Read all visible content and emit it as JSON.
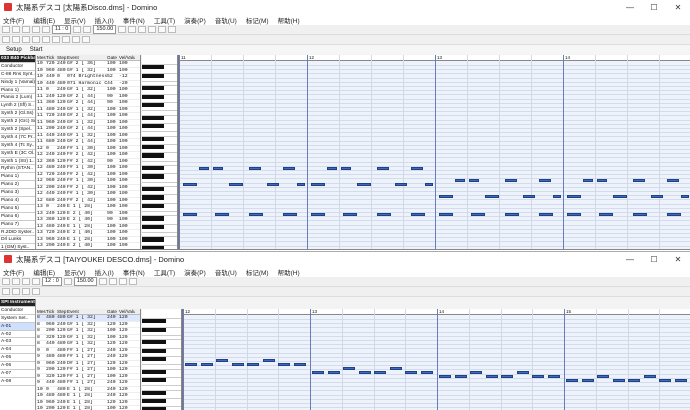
{
  "win1": {
    "title": "太陽系デスコ [太陽系Disco.dms] - Domino",
    "menu": [
      "文件(F)",
      "编辑(E)",
      "显示(V)",
      "插入(I)",
      "事件(N)",
      "工具(T)",
      "演奏(P)",
      "音轨(U)",
      "标记(M)",
      "帮助(H)"
    ],
    "measure": "11 : 0",
    "tempo": "150.00",
    "tabs": [
      "Setup",
      "Start"
    ],
    "track_header": "033 B40 Pickba 2 *0",
    "tracks": [
      "Conductor",
      "C-86 Rns Synt..",
      "Nindy 1 (Vamal)",
      "Piano 1)",
      "Pianio 2 (Lum)",
      "Lynth 2 (Sfl) S..",
      "Synth 2 (Gl.Ss)",
      "Synth 2 (Grc) Sun.",
      "Synth 2 (Spel..",
      "Synth 4 (7C Pr..",
      "Synth 4 (Tc Sy..",
      "Synth E (3C Ol..",
      "Synth 1 (Str) 1..",
      "Rythm (STAN..",
      "Piano 1)",
      "Piano 2)",
      "Piano 3)",
      "Piano 4)",
      "Piano 5)",
      "Piano 6)",
      "Piano 7)",
      "R.2DID Syster..",
      "Drl Lunks",
      "1 (GM) Syst.."
    ],
    "ev_cols": [
      "Mes",
      "Tick",
      "Step",
      "Event",
      "Gate",
      "Vel/Value"
    ],
    "events": [
      [
        "10",
        "720",
        "240",
        "G# 2 [ 36]",
        "100",
        "100"
      ],
      [
        "10",
        "960",
        "480",
        "G# 1 [ 32]",
        "100",
        "100"
      ],
      [
        "10",
        "440",
        "0",
        "074 Brightness 12(7 2)",
        "52",
        "-12"
      ],
      [
        "10",
        "440",
        "480",
        "071 Harmonic Content",
        "44",
        "-20"
      ],
      [
        "11",
        "0",
        "240",
        "G# 1 [ 32]",
        "100",
        "100"
      ],
      [
        "11",
        "240",
        "120",
        "G# 2 [ 44]",
        "90",
        "100"
      ],
      [
        "11",
        "360",
        "120",
        "G# 2 [ 44]",
        "90",
        "100"
      ],
      [
        "11",
        "480",
        "240",
        "G# 1 [ 32]",
        "100",
        "100"
      ],
      [
        "11",
        "720",
        "240",
        "G# 2 [ 44]",
        "100",
        "100"
      ],
      [
        "11",
        "960",
        "240",
        "G# 1 [ 32]",
        "100",
        "100"
      ],
      [
        "11",
        "200",
        "240",
        "G# 2 [ 44]",
        "100",
        "100"
      ],
      [
        "11",
        "440",
        "240",
        "G# 1 [ 32]",
        "100",
        "100"
      ],
      [
        "11",
        "680",
        "240",
        "G# 2 [ 44]",
        "100",
        "100"
      ],
      [
        "12",
        "0",
        "240",
        "F# 1 [ 30]",
        "100",
        "100"
      ],
      [
        "12",
        "240",
        "240",
        "F# 2 [ 42]",
        "100",
        "100"
      ],
      [
        "12",
        "360",
        "120",
        "F# 2 [ 42]",
        "90",
        "100"
      ],
      [
        "12",
        "480",
        "240",
        "F# 1 [ 30]",
        "100",
        "100"
      ],
      [
        "12",
        "720",
        "240",
        "F# 2 [ 42]",
        "100",
        "100"
      ],
      [
        "12",
        "960",
        "240",
        "F# 1 [ 30]",
        "100",
        "100"
      ],
      [
        "12",
        "200",
        "240",
        "F# 2 [ 42]",
        "100",
        "100"
      ],
      [
        "12",
        "440",
        "240",
        "F# 1 [ 30]",
        "100",
        "100"
      ],
      [
        "12",
        "680",
        "240",
        "F# 2 [ 42]",
        "100",
        "100"
      ],
      [
        "13",
        "0",
        "240",
        "E 1 [ 28]",
        "100",
        "100"
      ],
      [
        "13",
        "240",
        "120",
        "E 2 [ 40]",
        "90",
        "100"
      ],
      [
        "13",
        "360",
        "120",
        "E 2 [ 40]",
        "90",
        "100"
      ],
      [
        "13",
        "480",
        "240",
        "E 1 [ 28]",
        "100",
        "100"
      ],
      [
        "13",
        "720",
        "240",
        "E 2 [ 40]",
        "100",
        "100"
      ],
      [
        "13",
        "960",
        "240",
        "E 1 [ 28]",
        "100",
        "100"
      ],
      [
        "13",
        "200",
        "240",
        "E 2 [ 40]",
        "100",
        "100"
      ],
      [
        "13",
        "440",
        "240",
        "E 1 [ 28]",
        "100",
        "100"
      ],
      [
        "13",
        "680",
        "240",
        "E 2 [ 40]",
        "100",
        "100"
      ]
    ],
    "ruler": [
      "11",
      "12",
      "13",
      "14"
    ]
  },
  "win2": {
    "title": "太陽系デスコ [TAIYOUKEI DESCO.dms] - Domino",
    "menu": [
      "文件(F)",
      "编辑(E)",
      "显示(V)",
      "插入(I)",
      "事件(N)",
      "工具(T)",
      "演奏(P)",
      "音轨(U)",
      "标记(M)",
      "帮助(H)"
    ],
    "measure": "12 : 0",
    "tempo": "150.00",
    "track_header": "SPI Instrument Piano 1",
    "tracks": [
      "Conductor",
      "System Set..",
      "A-01",
      "A-02",
      "A-03",
      "A-04",
      "A-05",
      "A-06",
      "A-07",
      "A-08"
    ],
    "ev_cols": [
      "Mes",
      "Tick",
      "Step",
      "Event",
      "Gate",
      "Vel/Value"
    ],
    "events": [
      [
        "8",
        "480",
        "480",
        "G# 1 [ 32]",
        "240",
        "120"
      ],
      [
        "8",
        "960",
        "240",
        "G# 1 [ 32]",
        "120",
        "120"
      ],
      [
        "8",
        "200",
        "120",
        "G# 1 [ 32]",
        "100",
        "120"
      ],
      [
        "8",
        "320",
        "120",
        "G# 1 [ 32]",
        "100",
        "120"
      ],
      [
        "8",
        "440",
        "480",
        "G# 1 [ 32]",
        "120",
        "120"
      ],
      [
        "9",
        "0",
        "480",
        "F# 1 [ 27]",
        "240",
        "120"
      ],
      [
        "9",
        "480",
        "480",
        "F# 1 [ 27]",
        "240",
        "120"
      ],
      [
        "9",
        "960",
        "240",
        "D# 1 [ 27]",
        "120",
        "120"
      ],
      [
        "9",
        "200",
        "120",
        "F# 1 [ 27]",
        "100",
        "120"
      ],
      [
        "9",
        "320",
        "120",
        "F# 1 [ 27]",
        "100",
        "120"
      ],
      [
        "9",
        "440",
        "480",
        "F# 1 [ 27]",
        "240",
        "120"
      ],
      [
        "10",
        "0",
        "480",
        "E 1 [ 28]",
        "240",
        "120"
      ],
      [
        "10",
        "480",
        "480",
        "E 1 [ 28]",
        "240",
        "120"
      ],
      [
        "10",
        "960",
        "240",
        "E 1 [ 28]",
        "120",
        "120"
      ],
      [
        "10",
        "200",
        "120",
        "E 1 [ 28]",
        "100",
        "120"
      ]
    ],
    "ruler": [
      "12",
      "13",
      "14",
      "15"
    ]
  }
}
